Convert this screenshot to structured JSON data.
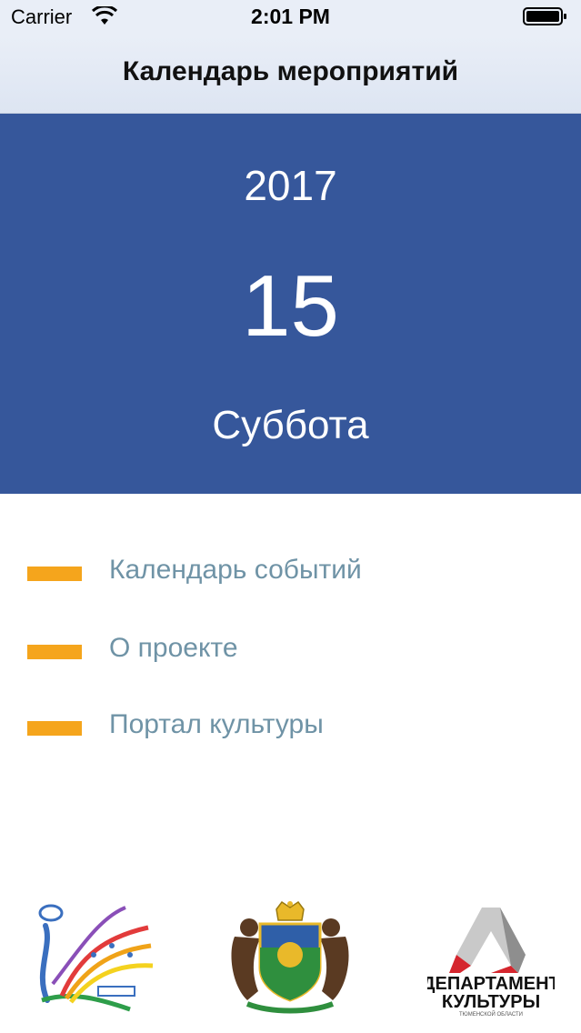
{
  "status_bar": {
    "carrier": "Carrier",
    "time": "2:01 PM"
  },
  "nav": {
    "title": "Календарь мероприятий"
  },
  "date": {
    "year": "2017",
    "day": "15",
    "weekday": "Суббота"
  },
  "menu": {
    "items": [
      {
        "label": "Календарь событий"
      },
      {
        "label": "О проекте"
      },
      {
        "label": "Портал культуры"
      }
    ]
  },
  "logos": {
    "department_line1": "ДЕПАРТАМЕНТ",
    "department_line2": "КУЛЬТУРЫ",
    "department_line3": "ТЮМЕНСКОЙ ОБЛАСТИ"
  },
  "colors": {
    "panel": "#36579b",
    "accent": "#f5a51c",
    "link": "#6f93a6",
    "nav_bg": "#e9eef7"
  }
}
